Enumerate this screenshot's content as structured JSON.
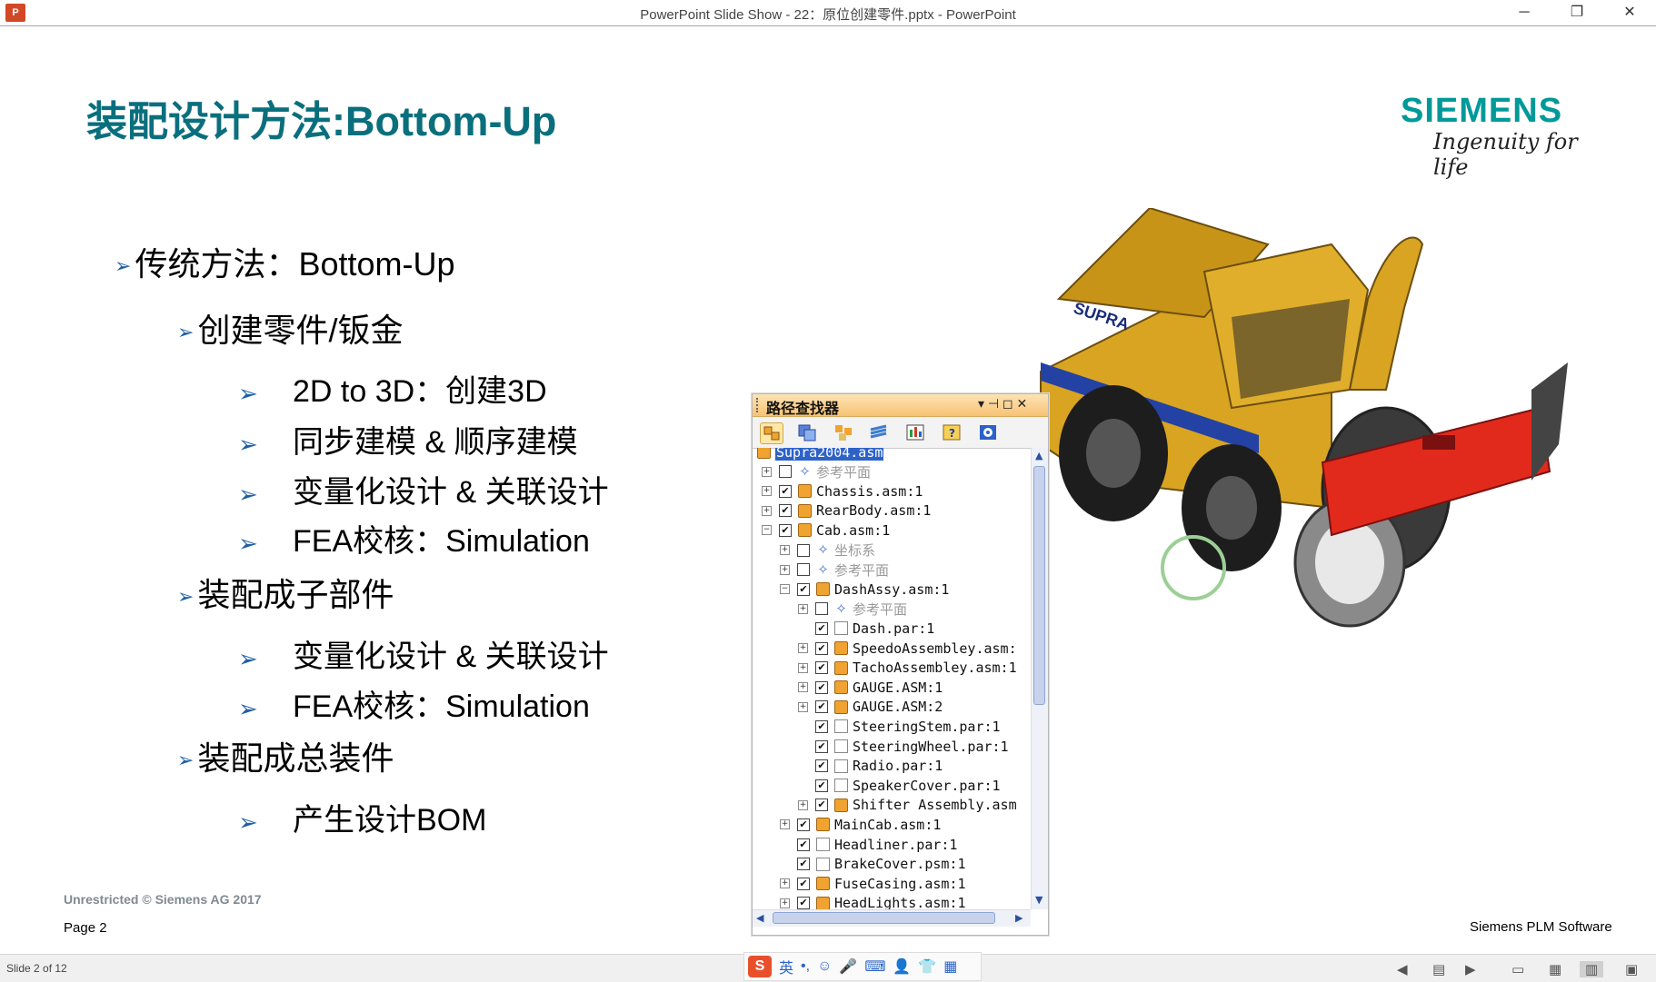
{
  "window": {
    "app_icon": "P",
    "title": "PowerPoint Slide Show  -  22：原位创建零件.pptx - PowerPoint",
    "minimize": "─",
    "restore": "❐",
    "close": "✕"
  },
  "slide": {
    "title": "装配设计方法:Bottom-Up",
    "brand_name": "SIEMENS",
    "brand_tagline": "Ingenuity for life",
    "bullets": [
      {
        "arrow": "➢",
        "text": "传统方法：Bottom-Up"
      },
      {
        "arrow": "➢",
        "text": "创建零件/钣金"
      },
      {
        "arrow": "➢",
        "text": "2D to 3D：创建3D"
      },
      {
        "arrow": "➢",
        "text": "同步建模 & 顺序建模"
      },
      {
        "arrow": "➢",
        "text": "变量化设计 & 关联设计"
      },
      {
        "arrow": "➢",
        "text": "FEA校核：Simulation"
      },
      {
        "arrow": "➢",
        "text": "装配成子部件"
      },
      {
        "arrow": "➢",
        "text": "变量化设计 & 关联设计"
      },
      {
        "arrow": "➢",
        "text": "FEA校核：Simulation"
      },
      {
        "arrow": "➢",
        "text": "装配成总装件"
      },
      {
        "arrow": "➢",
        "text": "产生设计BOM"
      }
    ],
    "footer_copyright": "Unrestricted © Siemens AG 2017",
    "footer_page": "Page 2",
    "footer_right": "Siemens PLM Software",
    "vehicle_label": "SUPRA"
  },
  "pathfinder": {
    "title": "路径查找器",
    "ctrl_pin": "▾ ⊣ ◻ ✕",
    "items": [
      {
        "label": "Supra2004.asm",
        "type": "asm",
        "exp": "",
        "chk": "",
        "state": "selected"
      },
      {
        "label": "参考平面",
        "type": "plane",
        "exp": "+",
        "chk": " ",
        "state": "grey"
      },
      {
        "label": "Chassis.asm:1",
        "type": "asm",
        "exp": "+",
        "chk": "✔",
        "state": ""
      },
      {
        "label": "RearBody.asm:1",
        "type": "asm",
        "exp": "+",
        "chk": "✔",
        "state": ""
      },
      {
        "label": "Cab.asm:1",
        "type": "asm",
        "exp": "−",
        "chk": "✔",
        "state": ""
      },
      {
        "label": "坐标系",
        "type": "plane",
        "exp": "+",
        "chk": " ",
        "state": "grey"
      },
      {
        "label": "参考平面",
        "type": "plane",
        "exp": "+",
        "chk": " ",
        "state": "grey"
      },
      {
        "label": "DashAssy.asm:1",
        "type": "asm",
        "exp": "−",
        "chk": "✔",
        "state": ""
      },
      {
        "label": "参考平面",
        "type": "plane",
        "exp": "+",
        "chk": " ",
        "state": "grey"
      },
      {
        "label": "Dash.par:1",
        "type": "par",
        "exp": "",
        "chk": "✔",
        "state": ""
      },
      {
        "label": "SpeedoAssembley.asm:",
        "type": "asm",
        "exp": "+",
        "chk": "✔",
        "state": ""
      },
      {
        "label": "TachoAssembley.asm:1",
        "type": "asm",
        "exp": "+",
        "chk": "✔",
        "state": ""
      },
      {
        "label": "GAUGE.ASM:1",
        "type": "asm",
        "exp": "+",
        "chk": "✔",
        "state": ""
      },
      {
        "label": "GAUGE.ASM:2",
        "type": "asm",
        "exp": "+",
        "chk": "✔",
        "state": ""
      },
      {
        "label": "SteeringStem.par:1",
        "type": "par",
        "exp": "",
        "chk": "✔",
        "state": ""
      },
      {
        "label": "SteeringWheel.par:1",
        "type": "par",
        "exp": "",
        "chk": "✔",
        "state": ""
      },
      {
        "label": "Radio.par:1",
        "type": "par",
        "exp": "",
        "chk": "✔",
        "state": ""
      },
      {
        "label": "SpeakerCover.par:1",
        "type": "par",
        "exp": "",
        "chk": "✔",
        "state": ""
      },
      {
        "label": "Shifter Assembly.asm",
        "type": "asm",
        "exp": "+",
        "chk": "✔",
        "state": ""
      },
      {
        "label": "MainCab.asm:1",
        "type": "asm",
        "exp": "+",
        "chk": "✔",
        "state": ""
      },
      {
        "label": "Headliner.par:1",
        "type": "par",
        "exp": "",
        "chk": "✔",
        "state": ""
      },
      {
        "label": "BrakeCover.psm:1",
        "type": "par",
        "exp": "",
        "chk": "✔",
        "state": ""
      },
      {
        "label": "FuseCasing.asm:1",
        "type": "asm",
        "exp": "+",
        "chk": "✔",
        "state": ""
      },
      {
        "label": "HeadLights.asm:1",
        "type": "asm",
        "exp": "+",
        "chk": "✔",
        "state": ""
      }
    ]
  },
  "statusbar": {
    "slide_count": "Slide 2 of 12",
    "ime_brand": "S",
    "ime_lang": "英",
    "ime_punct": "•,",
    "ime_icons": [
      "☺",
      "🎤",
      "⌨",
      "👤",
      "👕",
      "▦"
    ],
    "nav_prev": "◀",
    "nav_menu": "▤",
    "nav_next": "▶",
    "view_normal": "▭",
    "view_sorter": "▦",
    "view_reading": "▥",
    "view_slideshow": "▣"
  },
  "colors": {
    "title_teal": "#0a6f7d",
    "brand_teal": "#009999",
    "arrow_blue": "#1f5fa6",
    "panel_header": "#f7c374",
    "selection": "#2d62c9"
  }
}
